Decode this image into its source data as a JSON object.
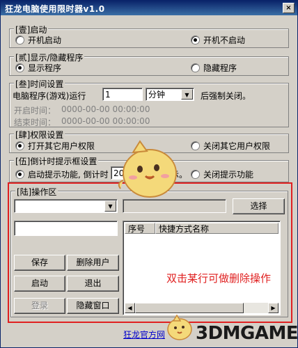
{
  "window": {
    "title": "狂龙电脑使用限时器v1.0",
    "close_glyph": "×"
  },
  "startup": {
    "legend": "[壹]启动",
    "opt_on": "开机启动",
    "opt_off": "开机不启动"
  },
  "display": {
    "legend": "[贰]显示/隐藏程序",
    "opt_show": "显示程序",
    "opt_hide": "隐藏程序"
  },
  "timing": {
    "legend": "[叁]时间设置",
    "run_label": "电脑程序(游戏)运行",
    "run_value": "1",
    "unit": "分钟",
    "after_label": "后强制关闭。",
    "start_label": "开启时间：",
    "start_value": "0000-00-00 00:00:00",
    "end_label": "结束时间：",
    "end_value": "0000-00-00 00:00:00"
  },
  "permission": {
    "legend": "[肆]权限设置",
    "opt_open": "打开其它用户权限",
    "opt_close": "关闭其它用户权限"
  },
  "countdown": {
    "legend": "[伍]倒计时提示框设置",
    "opt_enable": "启动提示功能, 倒计时",
    "seconds_value": "20",
    "after_text": "秒开始提示。",
    "opt_disable": "关闭提示功能"
  },
  "operation": {
    "legend": "[陆]操作区",
    "select_button": "选择",
    "col_index": "序号",
    "col_shortcut": "快捷方式名称",
    "save": "保存",
    "delete_user": "删除用户",
    "start": "启动",
    "exit": "退出",
    "login": "登录",
    "hide_window": "隐藏窗口"
  },
  "annotation": "双击某行可做删除操作",
  "footer": {
    "official_link": "狂龙官方网",
    "watermark": "3DMGAME"
  }
}
